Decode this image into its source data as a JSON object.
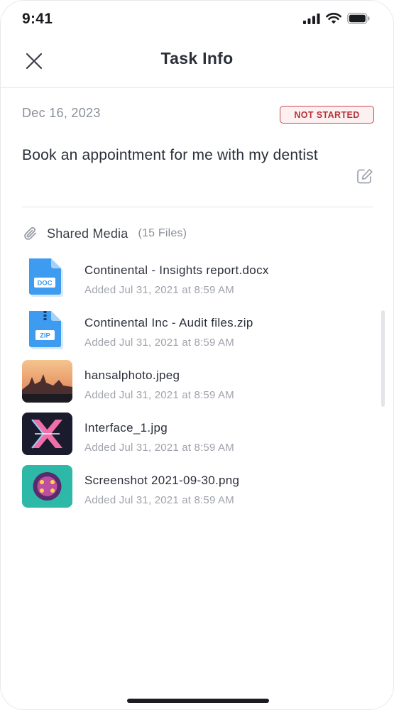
{
  "status_bar": {
    "time": "9:41"
  },
  "header": {
    "title": "Task Info"
  },
  "task": {
    "date": "Dec 16, 2023",
    "status": "NOT STARTED",
    "title": "Book an appointment for me with my dentist",
    "status_color": "#c9484d"
  },
  "shared_media": {
    "label": "Shared Media",
    "count": "(15 Files)",
    "files": [
      {
        "name": "Continental - Insights report.docx",
        "added": "Added Jul 31, 2021 at 8:59 AM",
        "icon": "doc-file-icon",
        "badge": "DOC"
      },
      {
        "name": "Continental Inc - Audit files.zip",
        "added": "Added Jul 31, 2021 at 8:59 AM",
        "icon": "zip-file-icon",
        "badge": "ZIP"
      },
      {
        "name": "hansalphoto.jpeg",
        "added": "Added Jul 31, 2021 at 8:59 AM",
        "icon": "image-thumbnail"
      },
      {
        "name": "Interface_1.jpg",
        "added": "Added Jul 31, 2021 at 8:59 AM",
        "icon": "image-thumbnail"
      },
      {
        "name": "Screenshot 2021-09-30.png",
        "added": "Added Jul 31, 2021 at 8:59 AM",
        "icon": "image-thumbnail"
      }
    ]
  },
  "colors": {
    "accent_blue": "#3d9bf0",
    "text_primary": "#2b2f3a",
    "text_muted": "#9fa3ab"
  }
}
